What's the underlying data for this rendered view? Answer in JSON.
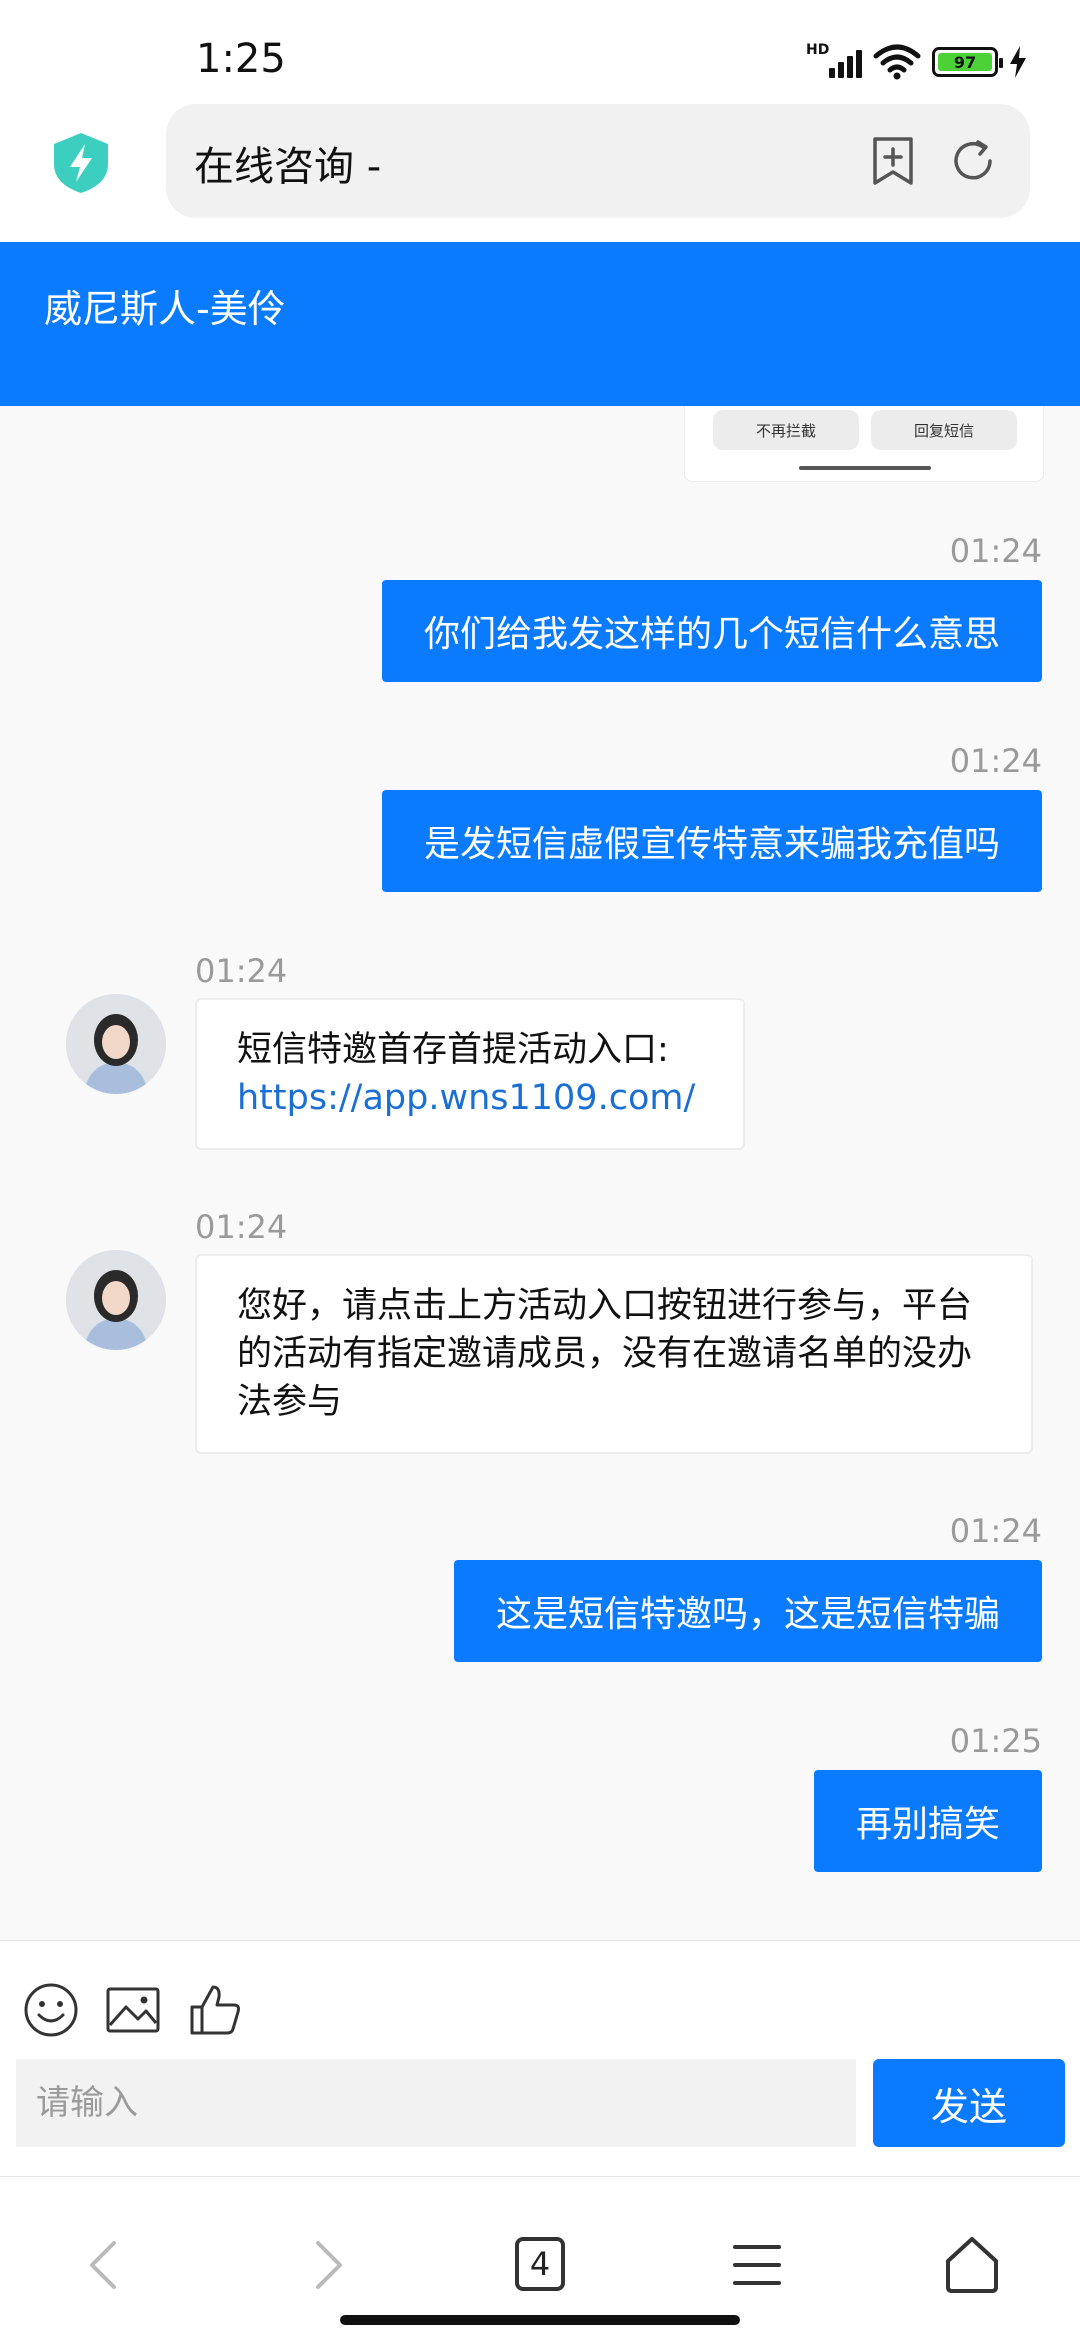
{
  "status_bar": {
    "time": "1:25",
    "network_label": "HD",
    "battery": "97"
  },
  "browser": {
    "url_text": "在线咨询 -"
  },
  "chat_header": {
    "title": "威尼斯人-美伶"
  },
  "previous_card": {
    "button_block": "不再拦截",
    "button_reply": "回复短信"
  },
  "messages": [
    {
      "time": "01:24",
      "text": "你们给我发这样的几个短信什么意思"
    },
    {
      "time": "01:24",
      "text": "是发短信虚假宣传特意来骗我充值吗"
    },
    {
      "time": "01:24",
      "text": "短信特邀首存首提活动入口:",
      "link": "https://app.wns1109.com/"
    },
    {
      "time": "01:24",
      "text": "您好，请点击上方活动入口按钮进行参与，平台的活动有指定邀请成员，没有在邀请名单的没办法参与"
    },
    {
      "time": "01:24",
      "text": "这是短信特邀吗，这是短信特骗"
    },
    {
      "time": "01:25",
      "text": "再别搞笑"
    }
  ],
  "input": {
    "placeholder": "请输入",
    "send_label": "发送"
  },
  "bottom_nav": {
    "tab_count": "4"
  },
  "colors": {
    "accent": "#0a7bff",
    "link": "#1a6fd4",
    "chat_bg": "#f9f9f9"
  }
}
